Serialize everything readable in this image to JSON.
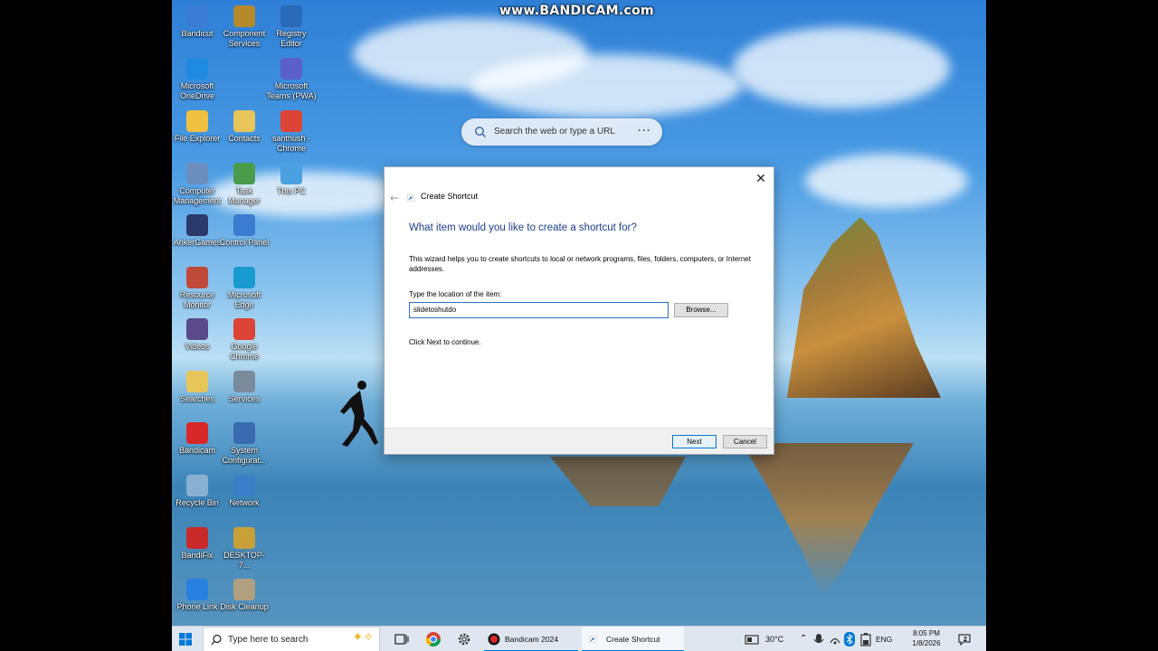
{
  "watermark": "www.BANDICAM.com",
  "desktop": {
    "icons": [
      {
        "label": "Bandicut",
        "color": "#3a7bd5"
      },
      {
        "label": "Component Services",
        "color": "#b58a2c"
      },
      {
        "label": "Registry Editor",
        "color": "#2a6ab8"
      },
      {
        "label": "Microsoft OneDrive",
        "color": "#1f8be0"
      },
      {
        "label": "Microsoft Teams (PWA)",
        "color": "#5b5fc7"
      },
      {
        "label": "File Explorer",
        "color": "#f0c040"
      },
      {
        "label": "Contacts",
        "color": "#e8c55a"
      },
      {
        "label": "santhush - Chrome",
        "color": "#db4437"
      },
      {
        "label": "Computer Management",
        "color": "#6a8fbf"
      },
      {
        "label": "Task Manager",
        "color": "#4a9b4a"
      },
      {
        "label": "This PC",
        "color": "#4aa0e0"
      },
      {
        "label": "AnkerGames",
        "color": "#2a3a6a"
      },
      {
        "label": "Control Panel",
        "color": "#3b7ccf"
      },
      {
        "label": "Resource Monitor",
        "color": "#c04a3a"
      },
      {
        "label": "Microsoft Edge",
        "color": "#1a9bd0"
      },
      {
        "label": "Videos",
        "color": "#5a4a8a"
      },
      {
        "label": "Google Chrome",
        "color": "#db4437"
      },
      {
        "label": "Searches",
        "color": "#e8c55a"
      },
      {
        "label": "Services",
        "color": "#7a8a9a"
      },
      {
        "label": "Bandicam",
        "color": "#d8282a"
      },
      {
        "label": "System Configurat...",
        "color": "#3a6ab0"
      },
      {
        "label": "Recycle Bin",
        "color": "#8ab0d0"
      },
      {
        "label": "Network",
        "color": "#3a80c8"
      },
      {
        "label": "BandiFix",
        "color": "#c82a2a"
      },
      {
        "label": "DESKTOP-7...",
        "color": "#c8a03a"
      },
      {
        "label": "Phone Link",
        "color": "#2a80e0"
      },
      {
        "label": "Disk Cleanup",
        "color": "#b0a080"
      }
    ]
  },
  "browser_search": {
    "placeholder": "Search the web or type a URL",
    "more": "···"
  },
  "dialog": {
    "title": "Create Shortcut",
    "heading": "What item would you like to create a shortcut for?",
    "description": "This wizard helps you to create shortcuts to local or network programs, files, folders, computers, or Internet addresses.",
    "location_label": "Type the location of the item:",
    "location_value": "slidetoshutdo",
    "browse_label": "Browse...",
    "hint": "Click Next to continue.",
    "next_label": "Next",
    "cancel_label": "Cancel",
    "close_glyph": "✕",
    "back_glyph": "←"
  },
  "taskbar": {
    "search_placeholder": "Type here to search",
    "apps": [
      {
        "label": "Bandicam 2024 (Un..."
      },
      {
        "label": "Create Shortcut"
      }
    ],
    "weather": "30°C",
    "language": "ENG",
    "time": "8:05 PM",
    "date": "1/8/2026",
    "notification_count": "2"
  }
}
